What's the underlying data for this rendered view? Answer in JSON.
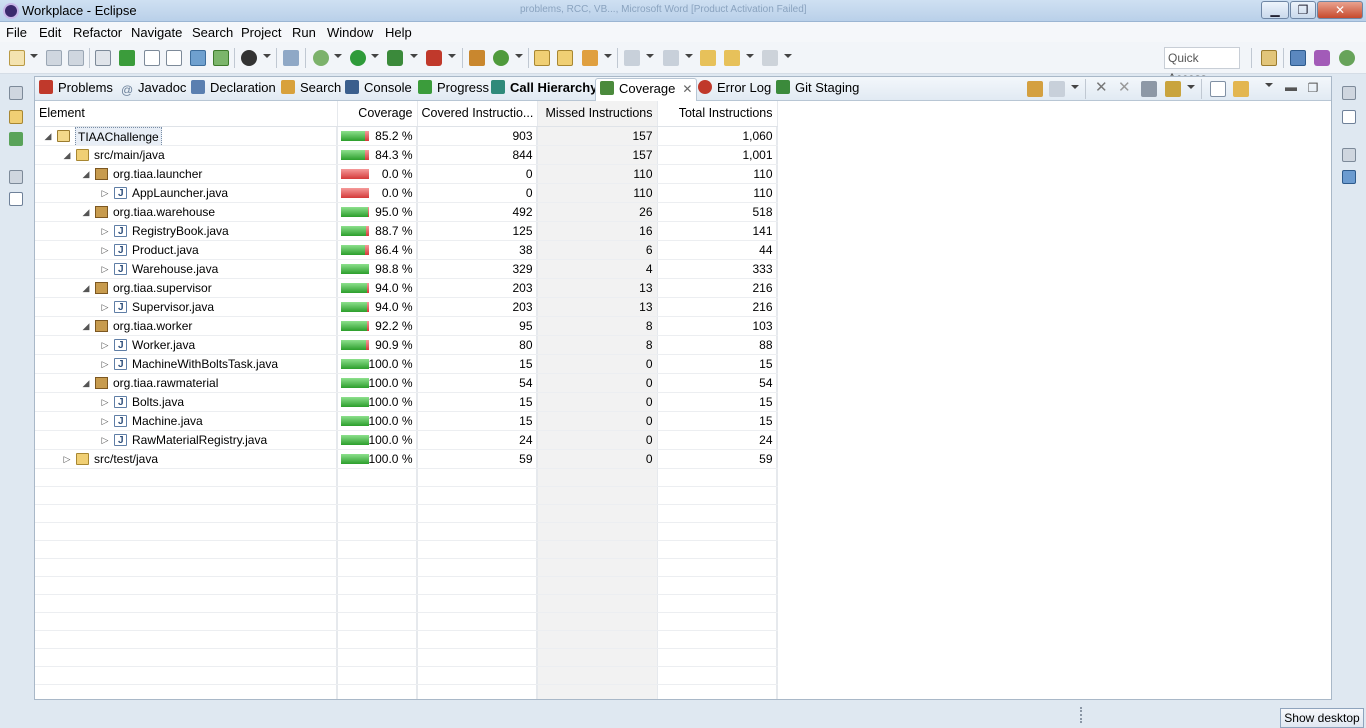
{
  "window": {
    "title": "Workplace - Eclipse",
    "ghost_title": "problems, RCC, VB..., Microsoft Word [Product Activation Failed]"
  },
  "menu": [
    "File",
    "Edit",
    "Refactor",
    "Navigate",
    "Search",
    "Project",
    "Run",
    "Window",
    "Help"
  ],
  "toolbar": {
    "quick_access": "Quick Access"
  },
  "tabs": [
    {
      "label": "Problems",
      "icon": "problems-icon",
      "color": "#c0392b"
    },
    {
      "label": "Javadoc",
      "icon": "at-icon",
      "color": "#6a7f99"
    },
    {
      "label": "Declaration",
      "icon": "declaration-icon",
      "color": "#5a7fb0"
    },
    {
      "label": "Search",
      "icon": "search-icon",
      "color": "#d8a13c"
    },
    {
      "label": "Console",
      "icon": "console-icon",
      "color": "#3b5f8d"
    },
    {
      "label": "Progress",
      "icon": "progress-icon",
      "color": "#3b9c3b"
    },
    {
      "label": "Call Hierarchy",
      "icon": "call-hierarchy-icon",
      "color": "#2f8a7a",
      "bold": true
    },
    {
      "label": "Coverage",
      "icon": "coverage-icon",
      "color": "#4b8a3c",
      "active": true
    },
    {
      "label": "Error Log",
      "icon": "error-log-icon",
      "color": "#c0392b"
    },
    {
      "label": "Git Staging",
      "icon": "git-staging-icon",
      "color": "#3b8a3b"
    }
  ],
  "table": {
    "columns": [
      "Element",
      "Coverage",
      "Covered Instructio...",
      "Missed Instructions",
      "Total Instructions"
    ],
    "rows": [
      {
        "name": "TIAAChallenge",
        "type": "project",
        "level": 0,
        "expanded": true,
        "coverage": "85.2 %",
        "covered": "903",
        "missed": "157",
        "total": "1,060",
        "frac": 0.852
      },
      {
        "name": "src/main/java",
        "type": "folder",
        "level": 1,
        "expanded": true,
        "coverage": "84.3 %",
        "covered": "844",
        "missed": "157",
        "total": "1,001",
        "frac": 0.843
      },
      {
        "name": "org.tiaa.launcher",
        "type": "package",
        "level": 2,
        "expanded": true,
        "coverage": "0.0 %",
        "covered": "0",
        "missed": "110",
        "total": "110",
        "frac": 0.0
      },
      {
        "name": "AppLauncher.java",
        "type": "java",
        "level": 3,
        "expanded": false,
        "coverage": "0.0 %",
        "covered": "0",
        "missed": "110",
        "total": "110",
        "frac": 0.0
      },
      {
        "name": "org.tiaa.warehouse",
        "type": "package",
        "level": 2,
        "expanded": true,
        "coverage": "95.0 %",
        "covered": "492",
        "missed": "26",
        "total": "518",
        "frac": 0.95
      },
      {
        "name": "RegistryBook.java",
        "type": "java",
        "level": 3,
        "expanded": false,
        "coverage": "88.7 %",
        "covered": "125",
        "missed": "16",
        "total": "141",
        "frac": 0.887
      },
      {
        "name": "Product.java",
        "type": "java",
        "level": 3,
        "expanded": false,
        "coverage": "86.4 %",
        "covered": "38",
        "missed": "6",
        "total": "44",
        "frac": 0.864
      },
      {
        "name": "Warehouse.java",
        "type": "java",
        "level": 3,
        "expanded": false,
        "coverage": "98.8 %",
        "covered": "329",
        "missed": "4",
        "total": "333",
        "frac": 0.988
      },
      {
        "name": "org.tiaa.supervisor",
        "type": "package",
        "level": 2,
        "expanded": true,
        "coverage": "94.0 %",
        "covered": "203",
        "missed": "13",
        "total": "216",
        "frac": 0.94
      },
      {
        "name": "Supervisor.java",
        "type": "java",
        "level": 3,
        "expanded": false,
        "coverage": "94.0 %",
        "covered": "203",
        "missed": "13",
        "total": "216",
        "frac": 0.94
      },
      {
        "name": "org.tiaa.worker",
        "type": "package",
        "level": 2,
        "expanded": true,
        "coverage": "92.2 %",
        "covered": "95",
        "missed": "8",
        "total": "103",
        "frac": 0.922
      },
      {
        "name": "Worker.java",
        "type": "java",
        "level": 3,
        "expanded": false,
        "coverage": "90.9 %",
        "covered": "80",
        "missed": "8",
        "total": "88",
        "frac": 0.909
      },
      {
        "name": "MachineWithBoltsTask.java",
        "type": "java",
        "level": 3,
        "expanded": false,
        "coverage": "100.0 %",
        "covered": "15",
        "missed": "0",
        "total": "15",
        "frac": 1.0
      },
      {
        "name": "org.tiaa.rawmaterial",
        "type": "package",
        "level": 2,
        "expanded": true,
        "coverage": "100.0 %",
        "covered": "54",
        "missed": "0",
        "total": "54",
        "frac": 1.0
      },
      {
        "name": "Bolts.java",
        "type": "java",
        "level": 3,
        "expanded": false,
        "coverage": "100.0 %",
        "covered": "15",
        "missed": "0",
        "total": "15",
        "frac": 1.0
      },
      {
        "name": "Machine.java",
        "type": "java",
        "level": 3,
        "expanded": false,
        "coverage": "100.0 %",
        "covered": "15",
        "missed": "0",
        "total": "15",
        "frac": 1.0
      },
      {
        "name": "RawMaterialRegistry.java",
        "type": "java",
        "level": 3,
        "expanded": false,
        "coverage": "100.0 %",
        "covered": "24",
        "missed": "0",
        "total": "24",
        "frac": 1.0
      },
      {
        "name": "src/test/java",
        "type": "folder",
        "level": 1,
        "expanded": false,
        "coverage": "100.0 %",
        "covered": "59",
        "missed": "0",
        "total": "59",
        "frac": 1.0
      }
    ]
  },
  "taskbar": {
    "show_desktop": "Show desktop"
  }
}
